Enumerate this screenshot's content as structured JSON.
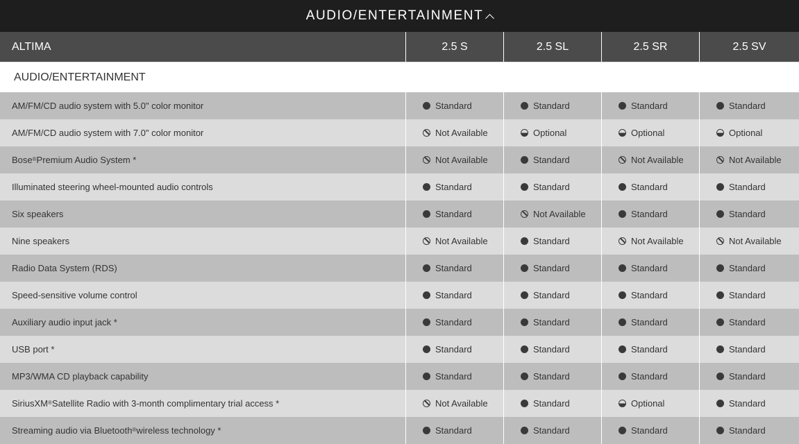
{
  "section_toggle": {
    "label": "AUDIO/ENTERTAINMENT"
  },
  "table": {
    "model": "ALTIMA",
    "trims": [
      "2.5 S",
      "2.5 SL",
      "2.5 SR",
      "2.5 SV"
    ],
    "section_title": "AUDIO/ENTERTAINMENT",
    "status_labels": {
      "standard": "Standard",
      "optional": "Optional",
      "na": "Not Available"
    },
    "rows": [
      {
        "feature": "AM/FM/CD audio system with 5.0\" color monitor",
        "values": [
          "standard",
          "standard",
          "standard",
          "standard"
        ]
      },
      {
        "feature": "AM/FM/CD audio system with 7.0\" color monitor",
        "values": [
          "na",
          "optional",
          "optional",
          "optional"
        ]
      },
      {
        "feature": "Bose",
        "sup": "®",
        "feature_rest": " Premium Audio System *",
        "values": [
          "na",
          "standard",
          "na",
          "na"
        ]
      },
      {
        "feature": "Illuminated steering wheel-mounted audio controls",
        "values": [
          "standard",
          "standard",
          "standard",
          "standard"
        ]
      },
      {
        "feature": "Six speakers",
        "values": [
          "standard",
          "na",
          "standard",
          "standard"
        ]
      },
      {
        "feature": "Nine speakers",
        "values": [
          "na",
          "standard",
          "na",
          "na"
        ]
      },
      {
        "feature": "Radio Data System (RDS)",
        "values": [
          "standard",
          "standard",
          "standard",
          "standard"
        ]
      },
      {
        "feature": "Speed-sensitive volume control",
        "values": [
          "standard",
          "standard",
          "standard",
          "standard"
        ]
      },
      {
        "feature": "Auxiliary audio input jack *",
        "values": [
          "standard",
          "standard",
          "standard",
          "standard"
        ]
      },
      {
        "feature": "USB port *",
        "values": [
          "standard",
          "standard",
          "standard",
          "standard"
        ]
      },
      {
        "feature": "MP3/WMA CD playback capability",
        "values": [
          "standard",
          "standard",
          "standard",
          "standard"
        ]
      },
      {
        "feature": "SiriusXM",
        "sup": "®",
        "feature_rest": " Satellite Radio with 3-month complimentary trial access *",
        "values": [
          "na",
          "standard",
          "optional",
          "standard"
        ]
      },
      {
        "feature": "Streaming audio via Bluetooth",
        "sup": "®",
        "feature_rest": " wireless technology *",
        "values": [
          "standard",
          "standard",
          "standard",
          "standard"
        ]
      }
    ]
  }
}
